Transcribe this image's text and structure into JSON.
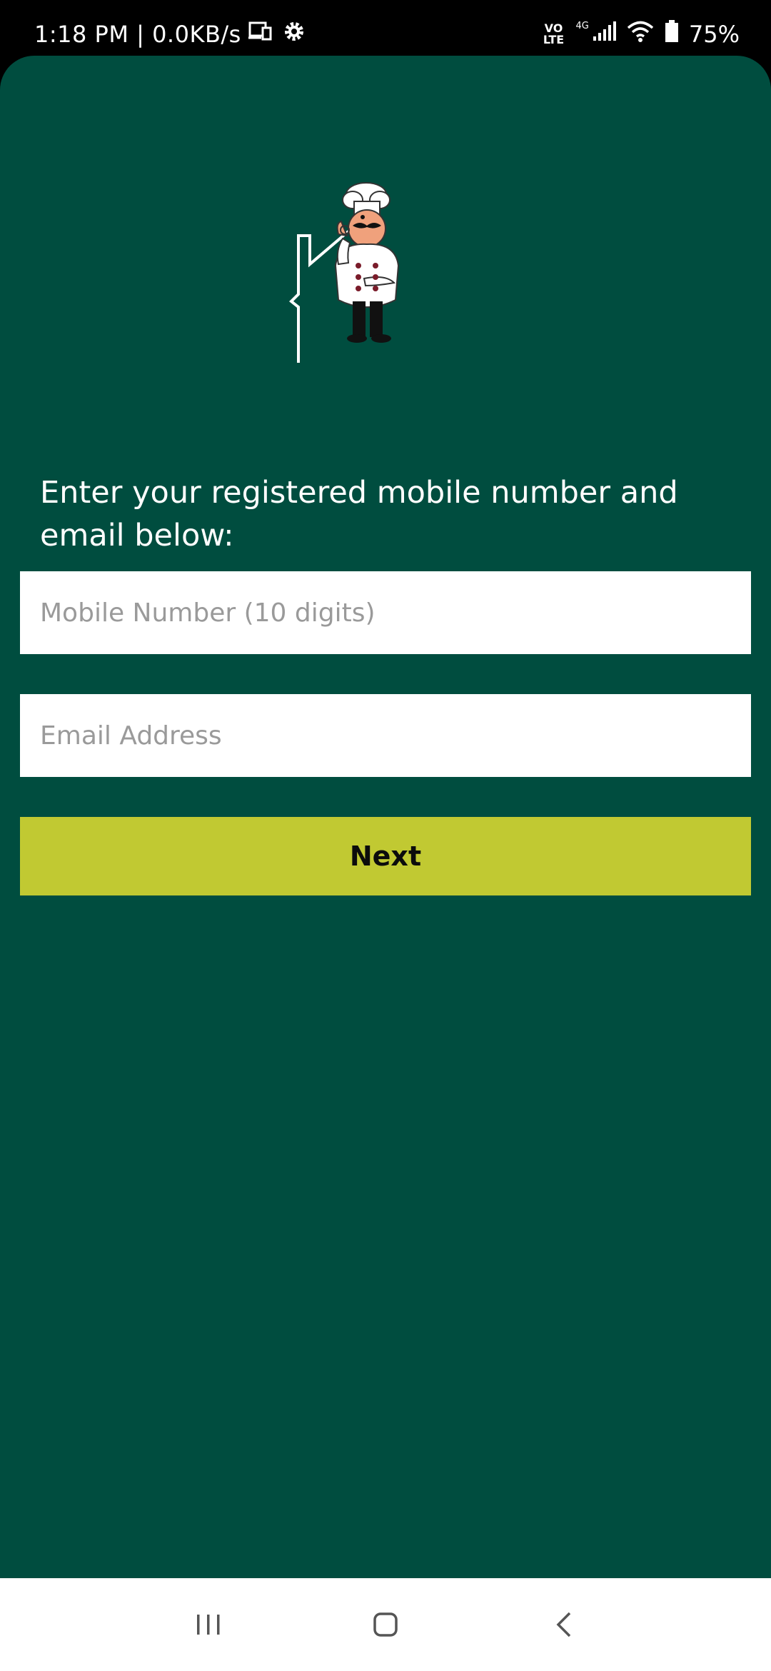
{
  "status_bar": {
    "time_speed": "1:18 PM | 0.0KB/s",
    "volte_top": "VO",
    "volte_bottom": "LTE",
    "network_type": "4G",
    "battery": "75%"
  },
  "icons": {
    "cast": "screen-cast-icon",
    "settings": "gear-icon",
    "signal": "signal-icon",
    "wifi": "wifi-icon",
    "battery": "battery-icon",
    "logo": "chef-house-logo",
    "recents": "recents-icon",
    "home": "home-icon",
    "back": "back-icon"
  },
  "colors": {
    "background": "#004d3f",
    "button": "#c1c932",
    "field": "#ffffff"
  },
  "form": {
    "heading": "Enter your registered mobile number and email below:",
    "mobile_placeholder": "Mobile Number (10 digits)",
    "email_placeholder": "Email Address",
    "next_label": "Next"
  }
}
